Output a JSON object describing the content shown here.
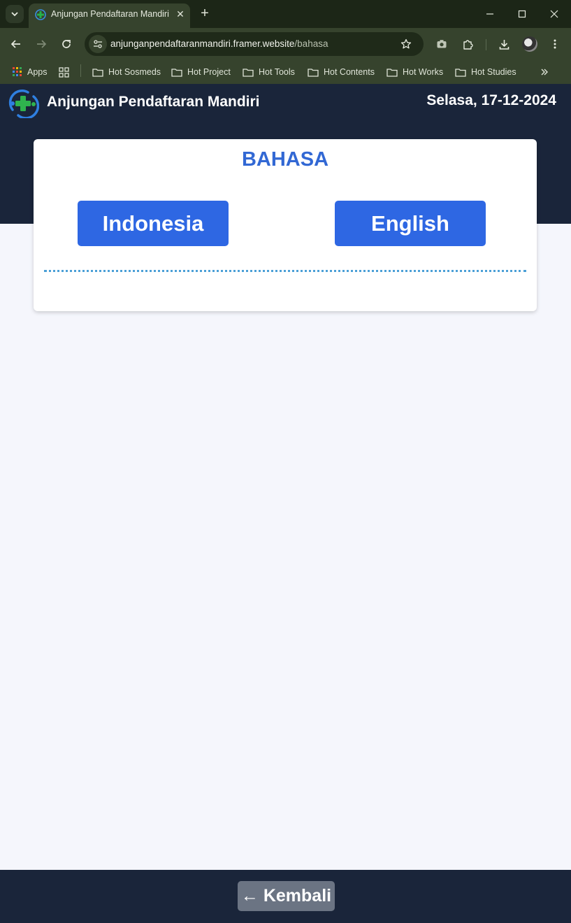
{
  "browser": {
    "tab_title": "Anjungan Pendaftaran Mandiri",
    "url_host": "anjunganpendaftaranmandiri.framer.website",
    "url_path": "/bahasa",
    "bookmarks": [
      "Apps",
      "Hot Sosmeds",
      "Hot Project",
      "Hot Tools",
      "Hot Contents",
      "Hot Works",
      "Hot Studies"
    ]
  },
  "header": {
    "title": "Anjungan Pendaftaran Mandiri",
    "date": "Selasa, 17-12-2024"
  },
  "card": {
    "title": "BAHASA",
    "options": [
      "Indonesia",
      "English"
    ]
  },
  "footer": {
    "back_label": "← Kembali"
  },
  "colors": {
    "header_bg": "#1a253a",
    "accent": "#2e67e3",
    "title_blue": "#3268d4",
    "back_button": "#6b7483",
    "browser_frame": "#36432d"
  }
}
